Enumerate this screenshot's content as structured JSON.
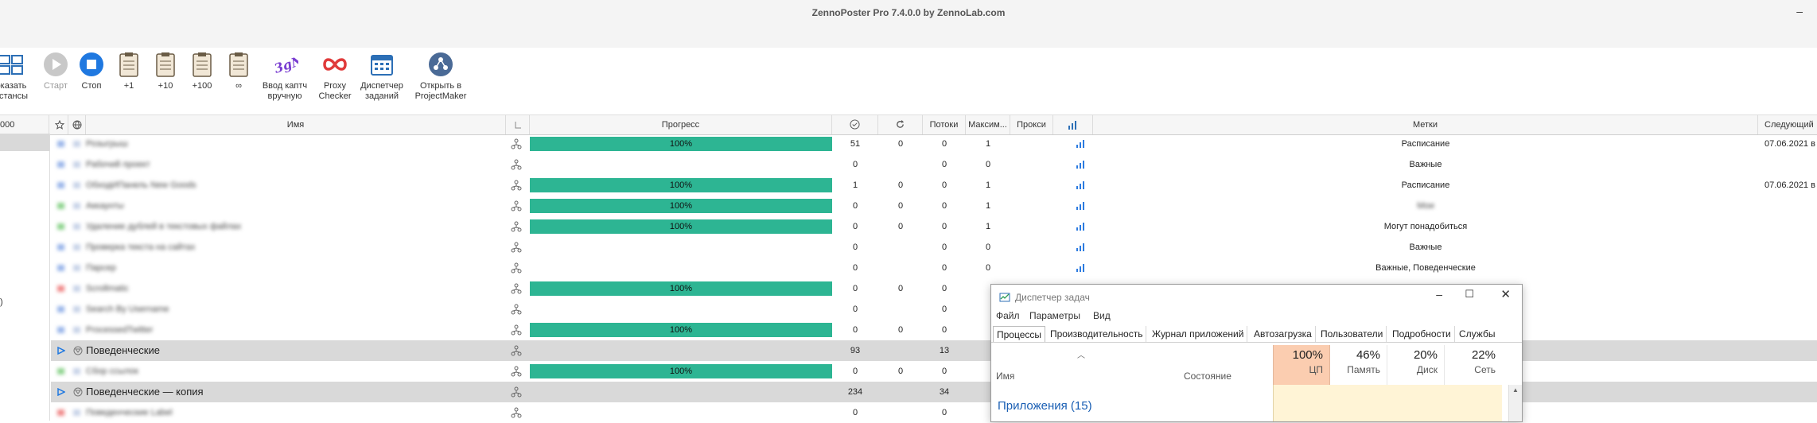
{
  "window": {
    "title": "ZennoPoster Pro 7.4.0.0 by ZennoLab.com",
    "minimize_glyph": "–"
  },
  "toolbar": {
    "items": [
      {
        "label": "оказать\nнстансы",
        "icon": "instances-icon",
        "disabled": false
      },
      {
        "label": "Старт",
        "icon": "play-icon",
        "disabled": true
      },
      {
        "label": "Стоп",
        "icon": "stop-icon",
        "disabled": false
      },
      {
        "label": "+1",
        "icon": "clipboard-icon",
        "disabled": false
      },
      {
        "label": "+10",
        "icon": "clipboard-icon",
        "disabled": false
      },
      {
        "label": "+100",
        "icon": "clipboard-icon",
        "disabled": false
      },
      {
        "label": "∞",
        "icon": "clipboard-icon",
        "disabled": false
      },
      {
        "label": "Ввод каптч\nвручную",
        "icon": "captcha-icon",
        "disabled": false
      },
      {
        "label": "Proxy\nChecker",
        "icon": "proxy-checker-icon",
        "disabled": false
      },
      {
        "label": "Диспетчер\nзаданий",
        "icon": "scheduler-icon",
        "disabled": false
      },
      {
        "label": "Открыть в\nProjectMaker",
        "icon": "projectmaker-icon",
        "disabled": false
      }
    ]
  },
  "left_pane": {
    "header": "000",
    "fragment": ")"
  },
  "columns": {
    "name": "Имя",
    "progress": "Прогресс",
    "threads": "Потоки",
    "max": "Максим...",
    "proxy": "Прокси",
    "tags": "Метки",
    "next": "Следующий"
  },
  "rows": [
    {
      "name": "Розыгрыш",
      "blur": true,
      "progress": 1.0,
      "progress_text": "100%",
      "done": "51",
      "retry": "0",
      "threads": "0",
      "max": "1",
      "tags": "Расписание",
      "next": "07.06.2021 в"
    },
    {
      "name": "Рабочий проект",
      "blur": true,
      "progress": null,
      "progress_text": "",
      "done": "0",
      "retry": "",
      "threads": "0",
      "max": "0",
      "tags": "Важные",
      "next": ""
    },
    {
      "name": "ОбходИПанель New Goods",
      "blur": true,
      "progress": 1.0,
      "progress_text": "100%",
      "done": "1",
      "retry": "0",
      "threads": "0",
      "max": "1",
      "tags": "Расписание",
      "next": "07.06.2021 в"
    },
    {
      "name": "Аккаунты",
      "blur": true,
      "progress": 1.0,
      "progress_text": "100%",
      "done": "0",
      "retry": "0",
      "threads": "0",
      "max": "1",
      "tags": "Мои",
      "next": ""
    },
    {
      "name": "Удаление дублей в текстовых файлах",
      "blur": true,
      "progress": 1.0,
      "progress_text": "100%",
      "done": "0",
      "retry": "0",
      "threads": "0",
      "max": "1",
      "tags": "Могут понадобиться",
      "next": ""
    },
    {
      "name": "Проверка текста на сайтах",
      "blur": true,
      "progress": null,
      "progress_text": "",
      "done": "0",
      "retry": "",
      "threads": "0",
      "max": "0",
      "tags": "Важные",
      "next": ""
    },
    {
      "name": "Парсер",
      "blur": true,
      "progress": null,
      "progress_text": "",
      "done": "0",
      "retry": "",
      "threads": "0",
      "max": "0",
      "tags": "Важные, Поведенческие",
      "next": ""
    },
    {
      "name": "Scrollmatic",
      "blur": true,
      "progress": 1.0,
      "progress_text": "100%",
      "done": "0",
      "retry": "0",
      "threads": "0",
      "max": "",
      "tags": "",
      "next": ""
    },
    {
      "name": "Search By Username",
      "blur": true,
      "progress": null,
      "progress_text": "",
      "done": "0",
      "retry": "",
      "threads": "0",
      "max": "",
      "tags": "",
      "next": ""
    },
    {
      "name": "ProcessedTwitter",
      "blur": true,
      "progress": 1.0,
      "progress_text": "100%",
      "done": "0",
      "retry": "0",
      "threads": "0",
      "max": "",
      "tags": "",
      "next": ""
    },
    {
      "name": "Поведенческие",
      "blur": false,
      "group": true,
      "progress": null,
      "progress_text": "",
      "done": "93",
      "retry": "",
      "threads": "13",
      "max": "",
      "tags": "",
      "next": ""
    },
    {
      "name": "Сбор ссылок",
      "blur": true,
      "progress": 1.0,
      "progress_text": "100%",
      "done": "0",
      "retry": "0",
      "threads": "0",
      "max": "",
      "tags": "",
      "next": ""
    },
    {
      "name": "Поведенческие — копия",
      "blur": false,
      "group": true,
      "progress": null,
      "progress_text": "",
      "done": "234",
      "retry": "",
      "threads": "34",
      "max": "",
      "tags": "",
      "next": ""
    },
    {
      "name": "Поведенческие Label",
      "blur": true,
      "progress": null,
      "progress_text": "",
      "done": "0",
      "retry": "",
      "threads": "0",
      "max": "",
      "tags": "",
      "next": ""
    }
  ],
  "task_manager": {
    "title": "Диспетчер задач",
    "menu": [
      "Файл",
      "Параметры",
      "Вид"
    ],
    "tabs": [
      "Процессы",
      "Производительность",
      "Журнал приложений",
      "Автозагрузка",
      "Пользователи",
      "Подробности",
      "Службы"
    ],
    "col_name": "Имя",
    "col_state": "Состояние",
    "metrics": [
      {
        "pct": "100%",
        "label": "ЦП"
      },
      {
        "pct": "46%",
        "label": "Память"
      },
      {
        "pct": "20%",
        "label": "Диск"
      },
      {
        "pct": "22%",
        "label": "Сеть"
      }
    ],
    "group_label": "Приложения (15)",
    "colors": {
      "cpu_header": "#fbcdb0",
      "cell_highlight": "#fff4d6"
    }
  },
  "colors": {
    "progress_fill": "#2db593",
    "group_row": "#d9d9d9",
    "accent_blue": "#1a73e8"
  }
}
